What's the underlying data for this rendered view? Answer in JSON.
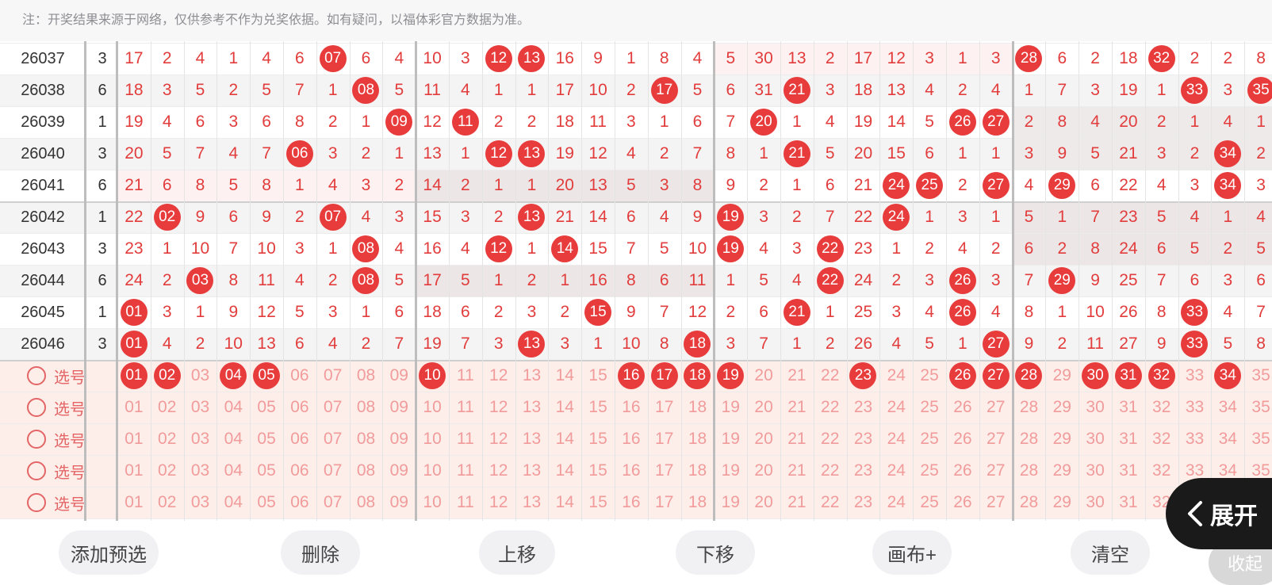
{
  "notice": "注：开奖结果来源于网络，仅供参考不作为兑奖依据。如有疑问，以福体彩官方数据为准。",
  "draw_rows": [
    {
      "period": "26037",
      "extra": "3",
      "cells": [
        "17",
        "2",
        "4",
        "1",
        "4",
        "6",
        "07",
        "6",
        "4",
        "10",
        "3",
        "12",
        "13",
        "16",
        "9",
        "1",
        "8",
        "4",
        "5",
        "30",
        "13",
        "2",
        "17",
        "12",
        "3",
        "1",
        "3",
        "28",
        "6",
        "2",
        "18",
        "32",
        "2",
        "2",
        "8"
      ],
      "balls": [
        6,
        11,
        12,
        27,
        31
      ]
    },
    {
      "period": "26038",
      "extra": "6",
      "cells": [
        "18",
        "3",
        "5",
        "2",
        "5",
        "7",
        "1",
        "08",
        "5",
        "11",
        "4",
        "1",
        "1",
        "17",
        "10",
        "2",
        "17",
        "5",
        "6",
        "31",
        "21",
        "3",
        "18",
        "13",
        "4",
        "2",
        "4",
        "1",
        "7",
        "3",
        "19",
        "1",
        "33",
        "3",
        "35"
      ],
      "balls": [
        7,
        16,
        20,
        32,
        34
      ]
    },
    {
      "period": "26039",
      "extra": "1",
      "cells": [
        "19",
        "4",
        "6",
        "3",
        "6",
        "8",
        "2",
        "1",
        "09",
        "12",
        "11",
        "2",
        "2",
        "18",
        "11",
        "3",
        "1",
        "6",
        "7",
        "20",
        "1",
        "4",
        "19",
        "14",
        "5",
        "26",
        "27",
        "2",
        "8",
        "4",
        "20",
        "2",
        "1",
        "4",
        "1"
      ],
      "balls": [
        8,
        10,
        19,
        25,
        26
      ]
    },
    {
      "period": "26040",
      "extra": "3",
      "cells": [
        "20",
        "5",
        "7",
        "4",
        "7",
        "06",
        "3",
        "2",
        "1",
        "13",
        "1",
        "12",
        "13",
        "19",
        "12",
        "4",
        "2",
        "7",
        "8",
        "1",
        "21",
        "5",
        "20",
        "15",
        "6",
        "1",
        "1",
        "3",
        "9",
        "5",
        "21",
        "3",
        "2",
        "34",
        "2"
      ],
      "balls": [
        5,
        11,
        12,
        20,
        33
      ]
    },
    {
      "period": "26041",
      "extra": "6",
      "cells": [
        "21",
        "6",
        "8",
        "5",
        "8",
        "1",
        "4",
        "3",
        "2",
        "14",
        "2",
        "1",
        "1",
        "20",
        "13",
        "5",
        "3",
        "8",
        "9",
        "2",
        "1",
        "6",
        "21",
        "24",
        "25",
        "2",
        "27",
        "4",
        "29",
        "6",
        "22",
        "4",
        "3",
        "34",
        "3"
      ],
      "balls": [
        23,
        24,
        26,
        28,
        33
      ]
    },
    {
      "period": "26042",
      "extra": "1",
      "cells": [
        "22",
        "02",
        "9",
        "6",
        "9",
        "2",
        "07",
        "4",
        "3",
        "15",
        "3",
        "2",
        "13",
        "21",
        "14",
        "6",
        "4",
        "9",
        "19",
        "3",
        "2",
        "7",
        "22",
        "24",
        "1",
        "3",
        "1",
        "5",
        "1",
        "7",
        "23",
        "5",
        "4",
        "1",
        "4"
      ],
      "balls": [
        1,
        6,
        12,
        18,
        23
      ]
    },
    {
      "period": "26043",
      "extra": "3",
      "cells": [
        "23",
        "1",
        "10",
        "7",
        "10",
        "3",
        "1",
        "08",
        "4",
        "16",
        "4",
        "12",
        "1",
        "14",
        "15",
        "7",
        "5",
        "10",
        "19",
        "4",
        "3",
        "22",
        "23",
        "1",
        "2",
        "4",
        "2",
        "6",
        "2",
        "8",
        "24",
        "6",
        "5",
        "2",
        "5"
      ],
      "balls": [
        7,
        11,
        13,
        18,
        21
      ]
    },
    {
      "period": "26044",
      "extra": "6",
      "cells": [
        "24",
        "2",
        "03",
        "8",
        "11",
        "4",
        "2",
        "08",
        "5",
        "17",
        "5",
        "1",
        "2",
        "1",
        "16",
        "8",
        "6",
        "11",
        "1",
        "5",
        "4",
        "22",
        "24",
        "2",
        "3",
        "26",
        "3",
        "7",
        "29",
        "9",
        "25",
        "7",
        "6",
        "3",
        "6"
      ],
      "balls": [
        2,
        7,
        21,
        25,
        28
      ]
    },
    {
      "period": "26045",
      "extra": "1",
      "cells": [
        "01",
        "3",
        "1",
        "9",
        "12",
        "5",
        "3",
        "1",
        "6",
        "18",
        "6",
        "2",
        "3",
        "2",
        "15",
        "9",
        "7",
        "12",
        "2",
        "6",
        "21",
        "1",
        "25",
        "3",
        "4",
        "26",
        "4",
        "8",
        "1",
        "10",
        "26",
        "8",
        "33",
        "4",
        "7"
      ],
      "balls": [
        0,
        14,
        20,
        25,
        32
      ]
    },
    {
      "period": "26046",
      "extra": "3",
      "cells": [
        "01",
        "4",
        "2",
        "10",
        "13",
        "6",
        "4",
        "2",
        "7",
        "19",
        "7",
        "3",
        "13",
        "3",
        "1",
        "10",
        "8",
        "18",
        "3",
        "7",
        "1",
        "2",
        "26",
        "4",
        "5",
        "1",
        "27",
        "9",
        "2",
        "11",
        "27",
        "9",
        "33",
        "5",
        "8"
      ],
      "balls": [
        0,
        12,
        17,
        26,
        32
      ]
    }
  ],
  "select_label": "选号",
  "numbers": [
    "01",
    "02",
    "03",
    "04",
    "05",
    "06",
    "07",
    "08",
    "09",
    "10",
    "11",
    "12",
    "13",
    "14",
    "15",
    "16",
    "17",
    "18",
    "19",
    "20",
    "21",
    "22",
    "23",
    "24",
    "25",
    "26",
    "27",
    "28",
    "29",
    "30",
    "31",
    "32",
    "33",
    "34",
    "35"
  ],
  "first_selected": [
    0,
    1,
    3,
    4,
    9,
    15,
    16,
    17,
    18,
    22,
    25,
    26,
    27,
    29,
    30,
    31,
    33
  ],
  "toolbar": {
    "add": "添加预选",
    "delete": "删除",
    "up": "上移",
    "down": "下移",
    "canvas": "画布+",
    "clear": "清空"
  },
  "expand_label": "展开",
  "collapse_label": "收起",
  "colors": {
    "accent": "#e83b3b",
    "pale": "#f19b9b",
    "selbg": "#fdeeea"
  }
}
